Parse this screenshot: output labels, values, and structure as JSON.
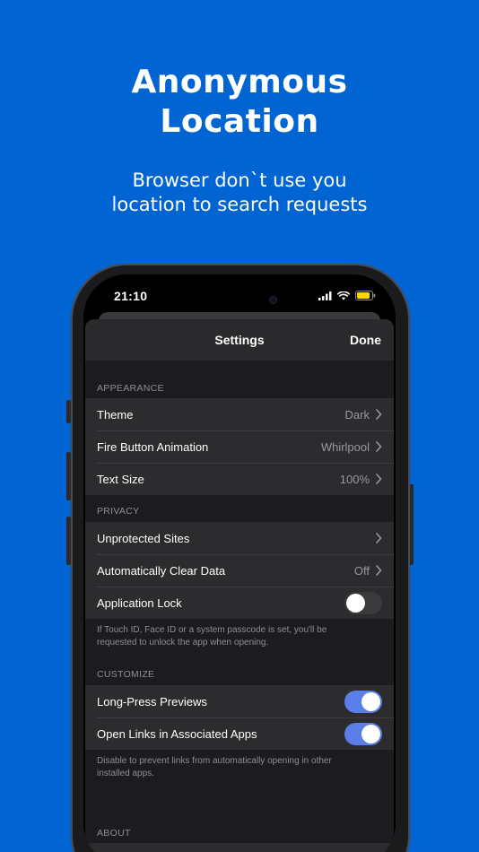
{
  "promo": {
    "headline_line1": "Anonymous",
    "headline_line2": "Location",
    "sub_line1": "Browser don`t use you",
    "sub_line2": "location to search requests"
  },
  "status_bar": {
    "time": "21:10",
    "icons": [
      "signal-icon",
      "wifi-icon",
      "battery-icon"
    ]
  },
  "settings": {
    "title": "Settings",
    "done_label": "Done",
    "appearance": {
      "header": "APPEARANCE",
      "theme": {
        "label": "Theme",
        "value": "Dark"
      },
      "fire_button": {
        "label": "Fire Button Animation",
        "value": "Whirlpool"
      },
      "text_size": {
        "label": "Text Size",
        "value": "100%"
      }
    },
    "privacy": {
      "header": "PRIVACY",
      "unprotected": {
        "label": "Unprotected Sites"
      },
      "auto_clear": {
        "label": "Automatically Clear Data",
        "value": "Off"
      },
      "app_lock": {
        "label": "Application Lock",
        "enabled": false
      },
      "footnote_line1": "If Touch ID, Face ID or a system passcode is set, you'll be",
      "footnote_line2": "requested to unlock the app when opening."
    },
    "customize": {
      "header": "CUSTOMIZE",
      "long_press": {
        "label": "Long-Press Previews",
        "enabled": true
      },
      "open_links": {
        "label": "Open Links in Associated Apps",
        "enabled": true
      },
      "footnote_line1": "Disable to prevent links from automatically opening in other",
      "footnote_line2": "installed apps."
    },
    "about": {
      "header": "ABOUT"
    }
  },
  "colors": {
    "background": "#0064d2",
    "toggle_on": "#5b7fe8",
    "sheet": "#1c1c1e",
    "cell": "#2c2c2e"
  }
}
